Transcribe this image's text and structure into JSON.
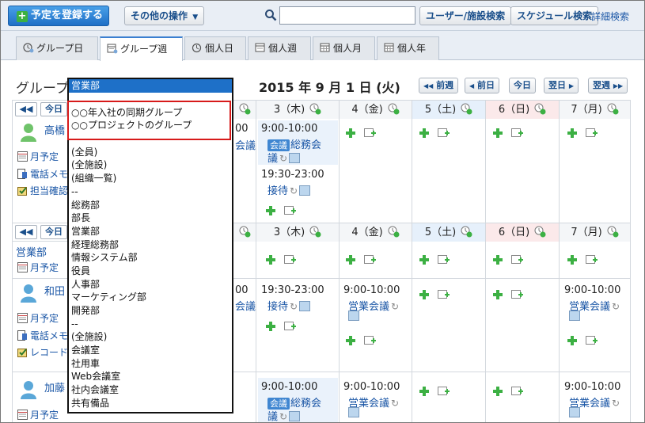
{
  "toolbar": {
    "register_label": "予定を登録する",
    "other_ops_label": "その他の操作",
    "search_value": "",
    "user_facility_search_label": "ユーザー/施設検索",
    "schedule_search_label": "スケジュール検索",
    "detail_search_label": "詳細検索"
  },
  "tabs": [
    {
      "label": "グループ日",
      "active": false
    },
    {
      "label": "グループ週",
      "active": true
    },
    {
      "label": "個人日",
      "active": false
    },
    {
      "label": "個人週",
      "active": false
    },
    {
      "label": "個人月",
      "active": false
    },
    {
      "label": "個人年",
      "active": false
    }
  ],
  "header": {
    "page_title": "グループ",
    "date_title": "2015 年 9 月 1 日 (火)",
    "prev_week": "前週",
    "prev_day": "前日",
    "today": "今日",
    "next_day": "翌日",
    "next_week": "翌週"
  },
  "days": [
    {
      "label": "3（木)",
      "type": "weekday"
    },
    {
      "label": "4（金)",
      "type": "weekday"
    },
    {
      "label": "5（土)",
      "type": "sat"
    },
    {
      "label": "6（日)",
      "type": "sun"
    },
    {
      "label": "7（月)",
      "type": "weekday"
    }
  ],
  "left": {
    "today_short": "今日",
    "user1_name": "高橋",
    "monthly_plan": "月予定",
    "phone_memo": "電話メモ",
    "tanto_kakunin": "担当確認",
    "group_label": "営業部",
    "user2_name": "和田",
    "record": "レコード",
    "user3_name": "加藤"
  },
  "events": {
    "cut_time_1": "00",
    "cut_title_1": "会議",
    "cut_time_2": "00",
    "cut_title_2": "会議",
    "r1_thu_1_time": "9:00-10:00",
    "r1_thu_1_tag": "会議",
    "r1_thu_1_title": "総務会",
    "r1_thu_1_title2": "議",
    "r1_thu_2_time": "19:30-23:00",
    "r1_thu_2_title": "接待",
    "r2_thu_time": "19:30-23:00",
    "r2_thu_title": "接待",
    "r2_fri_time": "9:00-10:00",
    "r2_fri_title": "営業会議",
    "r2_mon_time": "9:00-10:00",
    "r2_mon_title": "営業会議",
    "r3_thu_time": "9:00-10:00",
    "r3_thu_tag": "会議",
    "r3_thu_title": "総務会",
    "r3_thu_title2": "議",
    "r3_fri_time": "9:00-10:00",
    "r3_fri_title": "営業会議",
    "r3_mon_time": "9:00-10:00",
    "r3_mon_title": "営業会議"
  },
  "dropdown": {
    "selected": "営業部",
    "items": [
      "",
      "○○年入社の同期グループ",
      "○○プロジェクトのグループ",
      "--",
      "(全員)",
      "(全施設)",
      "(組織一覧)",
      "--",
      "総務部",
      "部長",
      "営業部",
      "経理総務部",
      "情報システム部",
      "役員",
      "人事部",
      "マーケティング部",
      "開発部",
      "--",
      "(全施設)",
      "会議室",
      "社用車",
      "Web会議室",
      "社内会議室",
      "共有備品"
    ]
  },
  "colors": {
    "accent": "#1e70c8",
    "highlight": "#d71a1a",
    "link": "#1a56a6"
  }
}
